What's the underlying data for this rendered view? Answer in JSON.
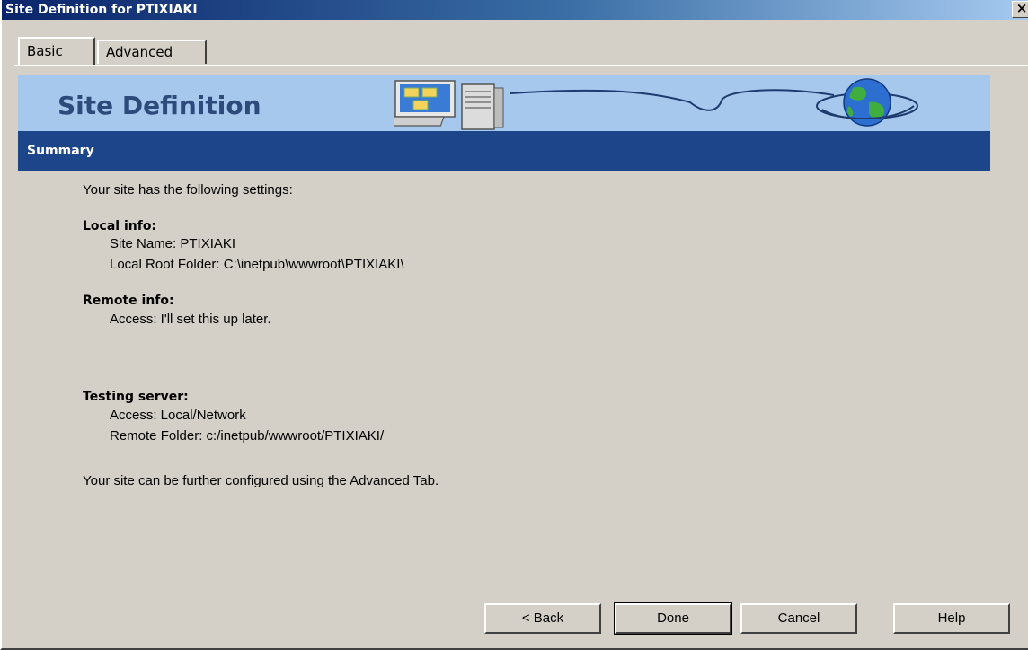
{
  "window": {
    "title": "Site Definition for PTIXIAKI",
    "close_glyph": "×"
  },
  "tabs": [
    {
      "label": "Basic",
      "selected": true
    },
    {
      "label": "Advanced",
      "selected": false
    }
  ],
  "banner": {
    "title": "Site Definition",
    "art": [
      "computer-icon",
      "globe-icon"
    ],
    "colors": {
      "background": "#a6c8ec",
      "title": "#2e4a7a"
    }
  },
  "section": {
    "label": "Summary",
    "color": "#1d4589"
  },
  "summary": {
    "intro": "Your site has the following settings:",
    "local": {
      "heading": "Local info:",
      "site_name": "Site Name: PTIXIAKI",
      "root_folder": "Local Root Folder: C:\\inetpub\\wwwroot\\PTIXIAKI\\"
    },
    "remote": {
      "heading": "Remote info:",
      "access": "Access: I'll set this up later."
    },
    "testing": {
      "heading": "Testing server:",
      "access": "Access: Local/Network",
      "folder": "Remote Folder: c:/inetpub/wwwroot/PTIXIAKI/"
    },
    "footer": "Your site can be further configured using the Advanced Tab."
  },
  "buttons": {
    "back": "< Back",
    "done": "Done",
    "cancel": "Cancel",
    "help": "Help"
  }
}
